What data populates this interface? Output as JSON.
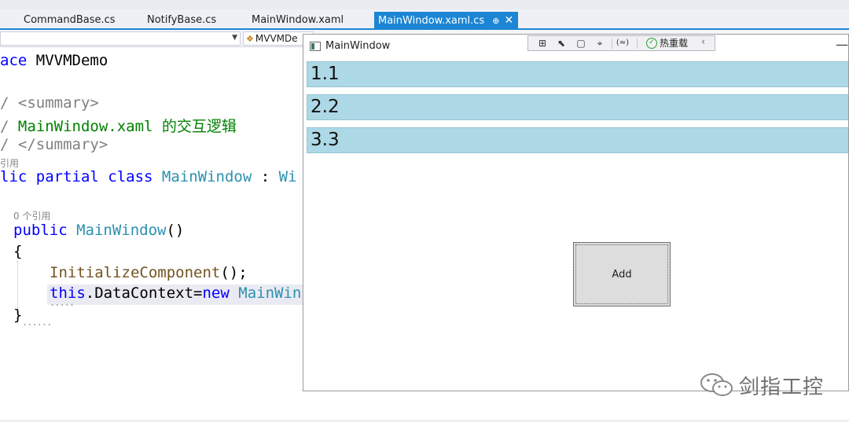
{
  "tabs": [
    {
      "label": "CommandBase.cs",
      "active": false
    },
    {
      "label": "NotifyBase.cs",
      "active": false
    },
    {
      "label": "MainWindow.xaml",
      "active": false
    },
    {
      "label": "MainWindow.xaml.cs",
      "active": true
    }
  ],
  "tab_pin_glyph": "⊕",
  "tab_close_glyph": "✕",
  "navbar": {
    "member_combo_value": "MVVMDe"
  },
  "editor": {
    "lines": {
      "ns_kw": "ace",
      "ns_name": " MVVMDemo",
      "doc1_slash": "/ ",
      "doc1_tag": "<summary>",
      "doc2_slash": "/ ",
      "doc2_text": "MainWindow.xaml 的交互逻辑",
      "doc3_slash": "/ ",
      "doc3_tag": "</summary>",
      "class_refs": "引用",
      "class_kw": "lic partial class",
      "class_name": " MainWindow",
      "class_rest": " : ",
      "class_base": "Wi",
      "ctor_refs": "0 个引用",
      "ctor_kw": "public",
      "ctor_name": " MainWindow",
      "ctor_paren": "()",
      "brace_open": "{",
      "init_call": "InitializeComponent",
      "init_rest": "();",
      "this_kw": "this",
      "dc_mid": ".DataContext=",
      "new_kw": "new",
      "new_type": " MainWin",
      "brace_close": "}"
    }
  },
  "wpf": {
    "title": "MainWindow",
    "minimize_glyph": "—",
    "hot_reload_label": "热重载",
    "items": [
      "1.1",
      "2.2",
      "3.3"
    ],
    "add_button": "Add"
  },
  "watermark": {
    "text": "剑指工控"
  },
  "colors": {
    "tab_active": "#1c85d4",
    "item_bg": "#add8e6",
    "keyword": "#0000ff",
    "type": "#2b91af",
    "comment": "#008000"
  },
  "icons": {
    "debug_toolbar": [
      "select-element-icon",
      "pointer-icon",
      "frame-icon",
      "layout-adorner-icon",
      "binding-icon"
    ],
    "hot_reload": "check-circle-icon",
    "watermark": "wechat-icon"
  }
}
